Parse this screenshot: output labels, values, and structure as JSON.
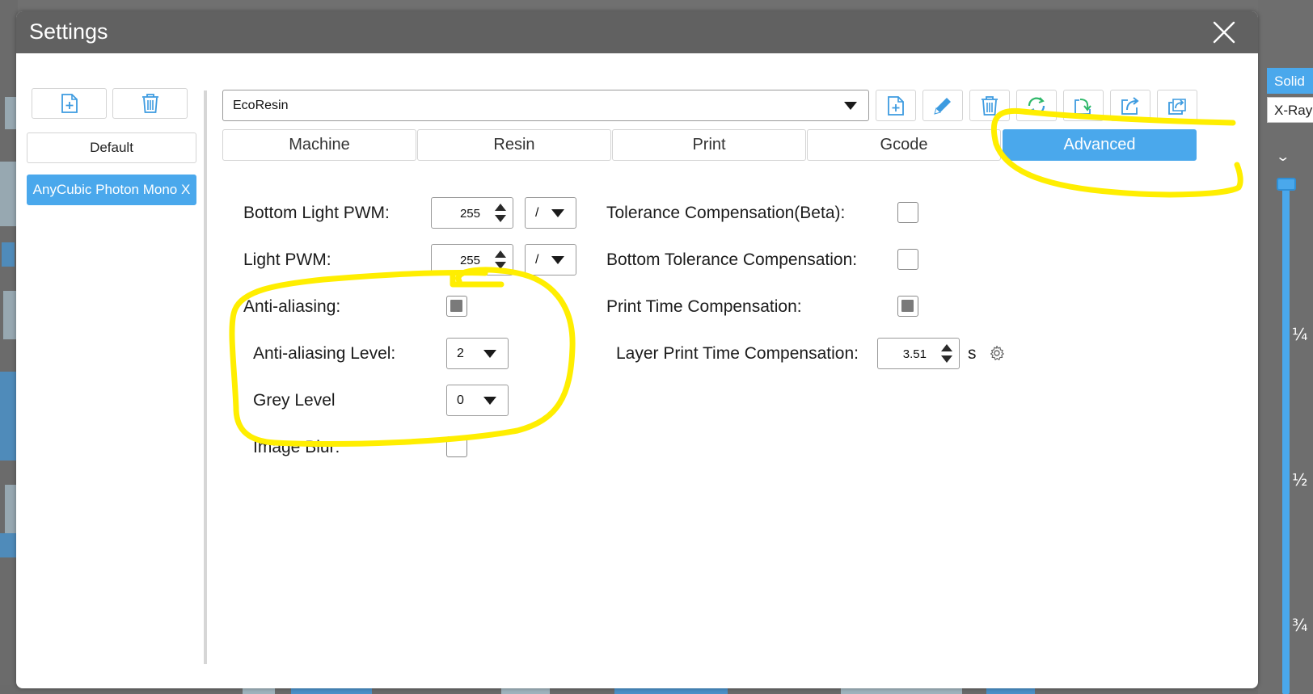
{
  "dialog": {
    "title": "Settings"
  },
  "profiles": {
    "items": [
      "Default",
      "AnyCubic Photon Mono X"
    ],
    "selected": "AnyCubic Photon Mono X"
  },
  "resin": {
    "selected": "EcoResin"
  },
  "tabs": [
    "Machine",
    "Resin",
    "Print",
    "Gcode",
    "Advanced"
  ],
  "active_tab": "Advanced",
  "advanced": {
    "bottom_light_pwm": {
      "label": "Bottom Light PWM:",
      "value": "255",
      "unit_option": "/"
    },
    "light_pwm": {
      "label": "Light PWM:",
      "value": "255",
      "unit_option": "/"
    },
    "anti_aliasing": {
      "label": "Anti-aliasing:",
      "checked": true
    },
    "anti_aliasing_level": {
      "label": "Anti-aliasing Level:",
      "value": "2"
    },
    "grey_level": {
      "label": "Grey Level",
      "value": "0"
    },
    "image_blur": {
      "label": "Image Blur:",
      "checked": false
    },
    "tolerance_compensation": {
      "label": "Tolerance Compensation(Beta):",
      "checked": false
    },
    "bottom_tolerance_compensation": {
      "label": "Bottom Tolerance Compensation:",
      "checked": false
    },
    "print_time_compensation": {
      "label": "Print Time Compensation:",
      "checked": true
    },
    "layer_print_time_compensation": {
      "label": "Layer Print Time Compensation:",
      "value": "3.51",
      "unit": "s"
    }
  },
  "right_panel": {
    "solid_label": "Solid",
    "xray_label": "X-Ray",
    "fractions": [
      "¼",
      "½",
      "¾"
    ]
  },
  "colors": {
    "accent": "#4aa8ec",
    "titlebar": "#616161",
    "highlight": "#ffee00"
  }
}
